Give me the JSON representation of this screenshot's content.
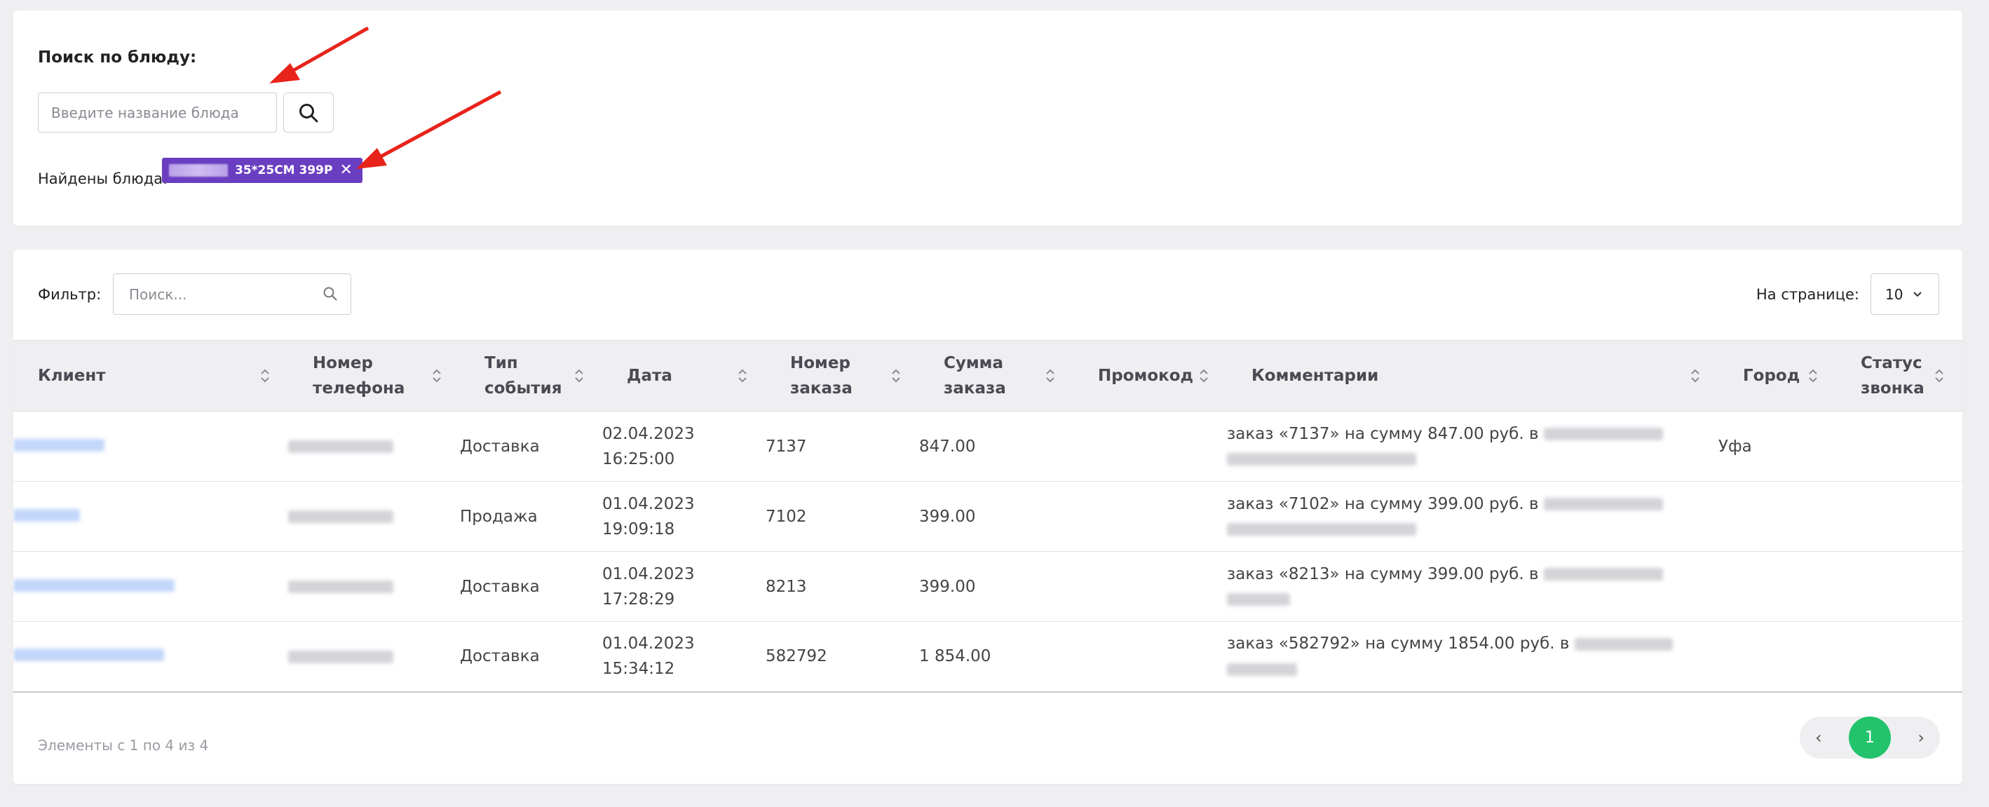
{
  "dish_search": {
    "title": "Поиск по блюду:",
    "input_placeholder": "Введите название блюда",
    "input_value": "",
    "search_icon": "search-icon",
    "found_label": "Найдены блюда:",
    "found_tag_text": "35*25СМ 399Р",
    "tag_color": "#6a3ec1"
  },
  "filter": {
    "label": "Фильтр:",
    "placeholder": "Поиск...",
    "value": ""
  },
  "per_page": {
    "label": "На странице:",
    "value": "10"
  },
  "table": {
    "columns": [
      {
        "line1": "Клиент",
        "line2": ""
      },
      {
        "line1": "Номер",
        "line2": "телефона"
      },
      {
        "line1": "Тип",
        "line2": "события"
      },
      {
        "line1": "Дата",
        "line2": ""
      },
      {
        "line1": "Номер",
        "line2": "заказа"
      },
      {
        "line1": "Сумма",
        "line2": "заказа"
      },
      {
        "line1": "Промокод",
        "line2": ""
      },
      {
        "line1": "Комментарии",
        "line2": ""
      },
      {
        "line1": "Город",
        "line2": ""
      },
      {
        "line1": "Статус",
        "line2": "звонка"
      }
    ],
    "rows": [
      {
        "event_type": "Доставка",
        "date": "02.04.2023",
        "time": "16:25:00",
        "order_number": "7137",
        "order_sum": "847.00",
        "promocode": "",
        "comment": "заказ «7137» на сумму 847.00 руб. в",
        "city": "Уфа",
        "call_status": ""
      },
      {
        "event_type": "Продажа",
        "date": "01.04.2023",
        "time": "19:09:18",
        "order_number": "7102",
        "order_sum": "399.00",
        "promocode": "",
        "comment": "заказ «7102» на сумму 399.00 руб. в",
        "city": "",
        "call_status": ""
      },
      {
        "event_type": "Доставка",
        "date": "01.04.2023",
        "time": "17:28:29",
        "order_number": "8213",
        "order_sum": "399.00",
        "promocode": "",
        "comment": "заказ «8213» на сумму 399.00 руб. в",
        "city": "",
        "call_status": ""
      },
      {
        "event_type": "Доставка",
        "date": "01.04.2023",
        "time": "15:34:12",
        "order_number": "582792",
        "order_sum": "1 854.00",
        "promocode": "",
        "comment": "заказ «582792» на сумму 1854.00 руб. в",
        "city": "",
        "call_status": ""
      }
    ]
  },
  "footer": {
    "info": "Элементы с 1 по 4 из 4",
    "current_page": "1",
    "prev_icon": "chevron-left-icon",
    "next_icon": "chevron-right-icon",
    "active_page_color": "#22c36b"
  },
  "annotation_color": "#e8231b"
}
